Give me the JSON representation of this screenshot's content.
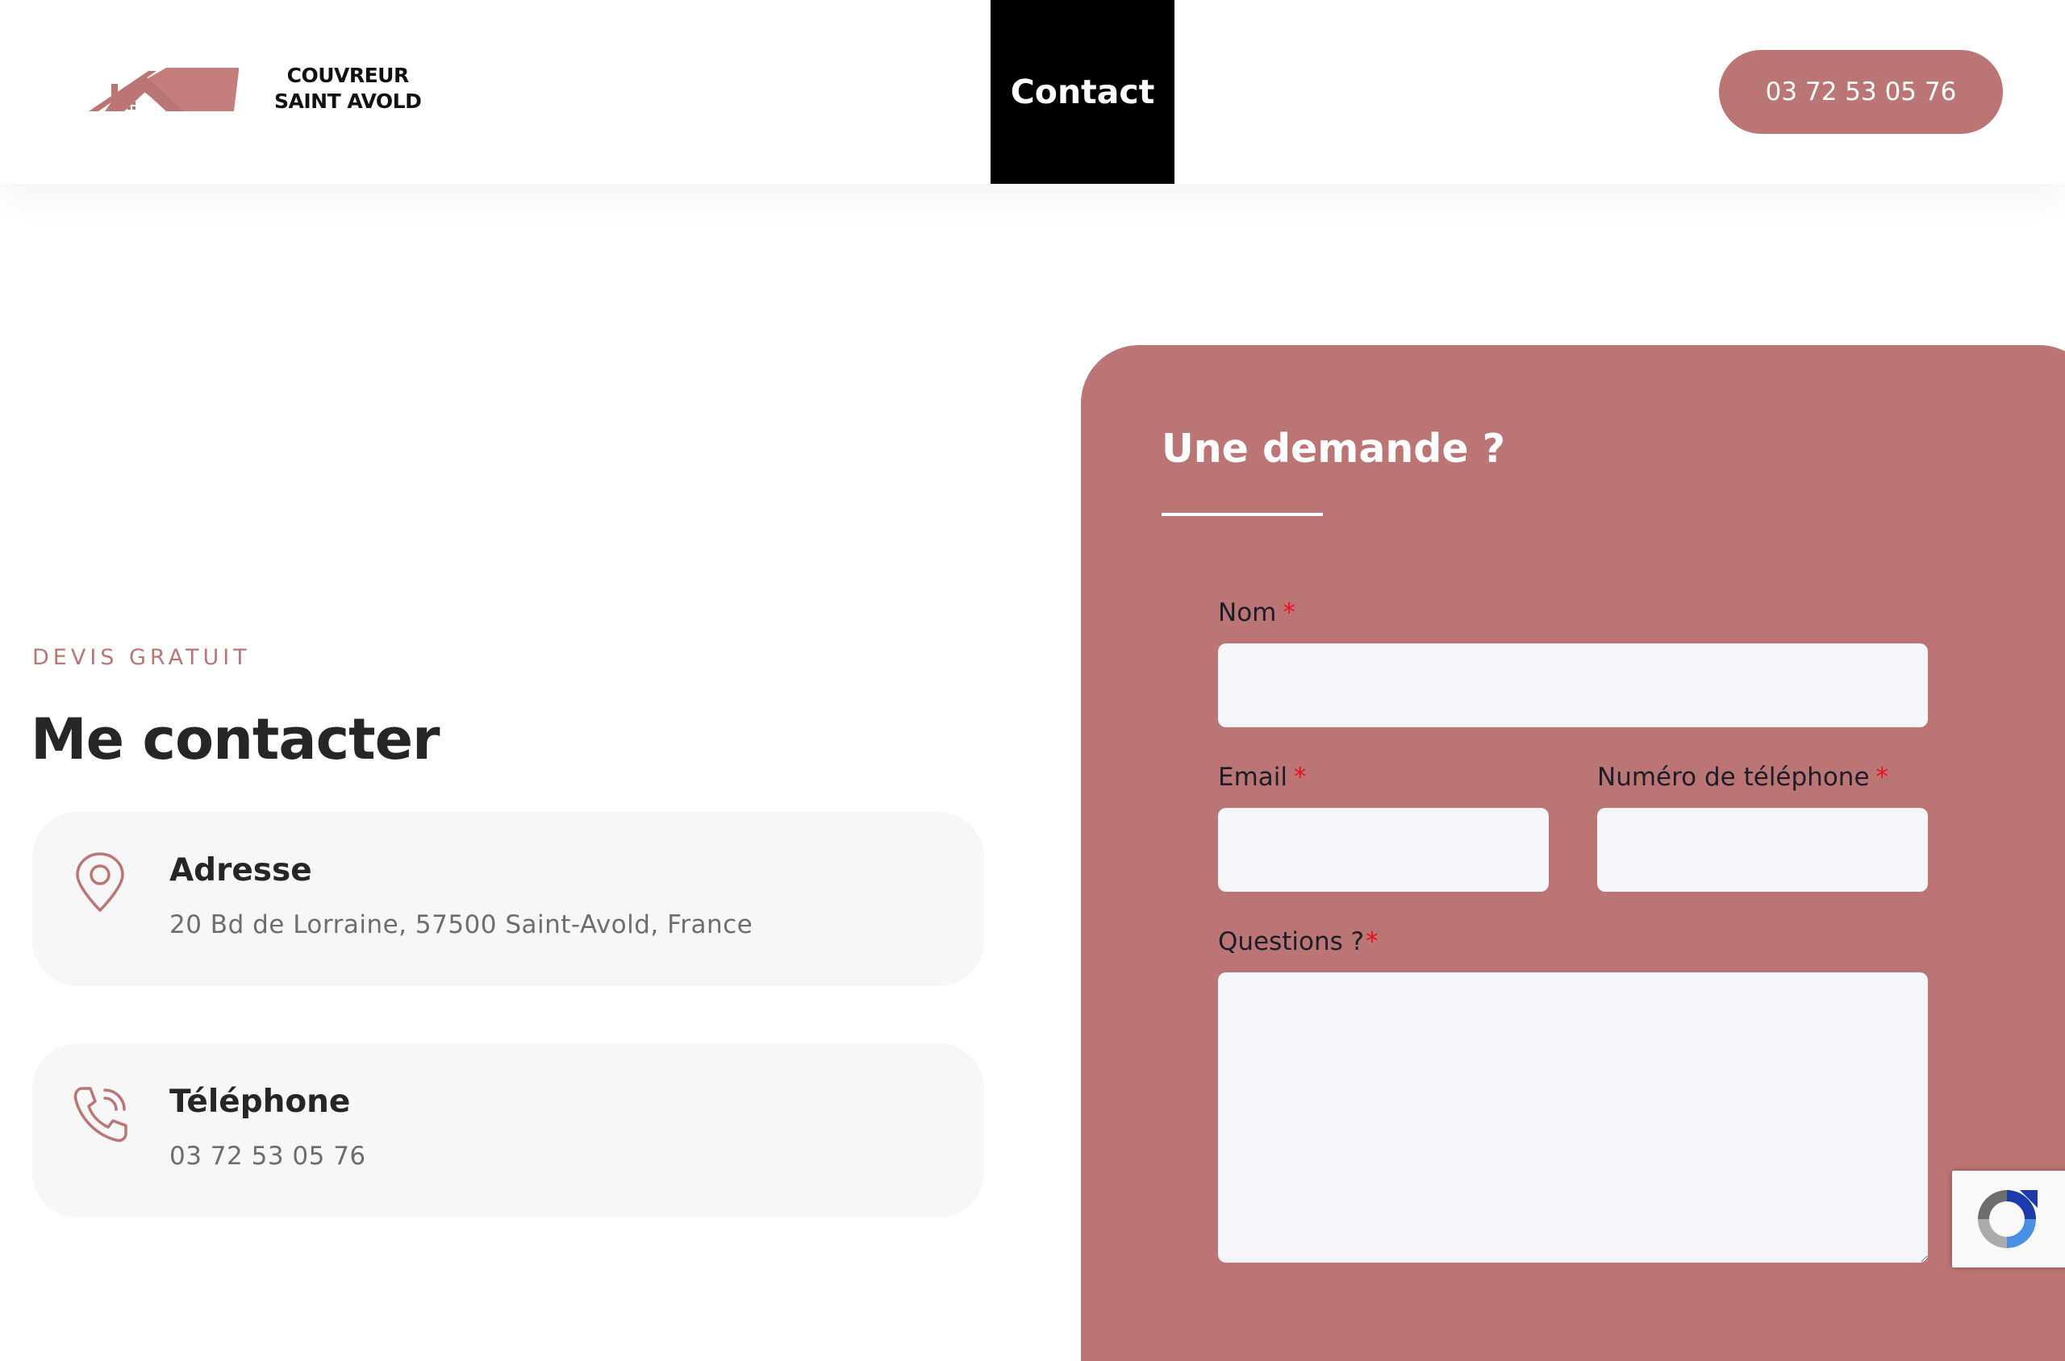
{
  "header": {
    "logo_line1": "COUVREUR",
    "logo_line2": "SAINT AVOLD",
    "nav_contact": "Contact",
    "phone_button": "03 72 53 05 76"
  },
  "contact": {
    "eyebrow": "DEVIS GRATUIT",
    "heading": "Me contacter",
    "address": {
      "icon": "map-pin-icon",
      "title": "Adresse",
      "text": "20 Bd de Lorraine, 57500 Saint-Avold, France"
    },
    "phone": {
      "icon": "phone-icon",
      "title": "Téléphone",
      "text": "03 72 53 05 76"
    }
  },
  "form": {
    "title": "Une demande ?",
    "fields": {
      "nom": {
        "label": "Nom",
        "required_mark": "*",
        "value": ""
      },
      "email": {
        "label": "Email",
        "required_mark": "*",
        "value": ""
      },
      "telephone": {
        "label": "Numéro de téléphone",
        "required_mark": "*",
        "value": ""
      },
      "questions": {
        "label": "Questions ?",
        "required_mark": "*",
        "value": ""
      }
    }
  },
  "colors": {
    "accent": "#bb7574",
    "dark": "#262626",
    "card_bg": "#f7f7f7",
    "input_bg": "#f5f6fa",
    "required": "#e8111a"
  },
  "badges": {
    "recaptcha_icon": "recaptcha-icon"
  }
}
